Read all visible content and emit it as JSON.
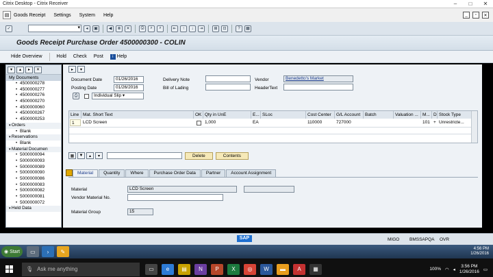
{
  "window": {
    "title": "Citrix Desktop - Citrix Receiver"
  },
  "menu": {
    "items": [
      "Goods Receipt",
      "Settings",
      "System",
      "Help"
    ]
  },
  "page": {
    "title": "Goods Receipt Purchase Order 4500000300 - COLIN"
  },
  "app_toolbar": {
    "hide_overview": "Hide Overview",
    "hold": "Hold",
    "check": "Check",
    "post": "Post",
    "help": "Help"
  },
  "nav": {
    "my_documents_label": "My Documents",
    "my_documents": [
      "4500000278",
      "4500000277",
      "4500000276",
      "4500000270",
      "4500000060",
      "4500000267",
      "4500000253"
    ],
    "orders_label": "Orders",
    "orders": [
      "Blank"
    ],
    "reservations_label": "Reservations",
    "reservations": [
      "Blank"
    ],
    "material_docs_label": "Material Documen",
    "material_docs": [
      "5000000094",
      "5000000093",
      "5000000089",
      "5000000090",
      "5000000086",
      "5000000083",
      "5000000082",
      "5000000081",
      "5000000072"
    ],
    "held_data_label": "Held Data"
  },
  "header": {
    "document_date_label": "Document Date",
    "document_date": "01/26/2016",
    "posting_date_label": "Posting Date",
    "posting_date": "01/26/2016",
    "delivery_note_label": "Delivery Note",
    "delivery_note": "",
    "bill_of_lading_label": "Bill of Lading",
    "bill_of_lading": "",
    "vendor_label": "Vendor",
    "vendor": "Benedetto's Market",
    "header_text_label": "HeaderText",
    "header_text": "",
    "slip_option": "Individual Slip"
  },
  "items": {
    "columns": [
      "Line",
      "Mat. Short Text",
      "OK",
      "Qty in UnE",
      "E...",
      "SLoc",
      "Cost Center",
      "G/L Account",
      "Batch",
      "Valuation ...",
      "M...",
      "D",
      "Stock Type"
    ],
    "rows": [
      {
        "line": "1",
        "mat_short_text": "LCD Screen",
        "qty": "1,000",
        "unit": "EA",
        "cost_center": "110000",
        "gl_account": "727000",
        "m": "101",
        "d": "+",
        "stock_type": "Unrestricte..."
      }
    ]
  },
  "table_toolbar": {
    "delete_label": "Delete",
    "contents_label": "Contents"
  },
  "detail_tabs": [
    "Material",
    "Quantity",
    "Where",
    "Purchase Order Data",
    "Partner",
    "Account Assignment"
  ],
  "detail": {
    "material_label": "Material",
    "material_value": "LCD Screen",
    "vendor_material_label": "Vendor Material No.",
    "vendor_material_value": "",
    "material_group_label": "Material Group",
    "material_group_value": "15"
  },
  "status_bar": {
    "logo": "SAP",
    "transaction": "MIGO",
    "server": "BMSSAPQA",
    "mode": "OVR"
  },
  "citrix_taskbar": {
    "start_label": "Start",
    "time": "4:56 PM",
    "date": "1/26/2016"
  },
  "windows_taskbar": {
    "search_placeholder": "Ask me anything",
    "battery": "100%",
    "time": "3:56 PM",
    "date": "1/26/2016"
  }
}
